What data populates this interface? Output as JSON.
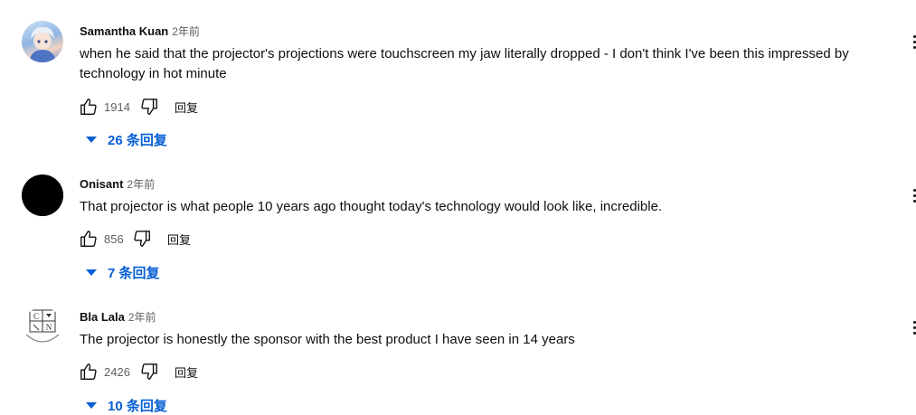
{
  "comments": [
    {
      "author": "Samantha Kuan",
      "time": "2年前",
      "text": "when he said that the projector's projections were touchscreen my jaw literally dropped - I don't think I've been this impressed by technology in hot minute",
      "likes": "1914",
      "reply_label": "回复",
      "replies_label": "26 条回复",
      "avatar": "anime-avatar"
    },
    {
      "author": "Onisant",
      "time": "2年前",
      "text": "That projector is what people 10 years ago thought today's technology would look like, incredible.",
      "likes": "856",
      "reply_label": "回复",
      "replies_label": "7 条回复",
      "avatar": "black-circle-avatar"
    },
    {
      "author": "Bla Lala",
      "time": "2年前",
      "text": "The projector is honestly the sponsor with the best product I have seen in 14 years",
      "likes": "2426",
      "reply_label": "回复",
      "replies_label": "10 条回复",
      "avatar": "logo-avatar",
      "avatar_letters": [
        "C",
        "N"
      ]
    }
  ],
  "icons": {
    "like": "thumbs-up-icon",
    "dislike": "thumbs-down-icon",
    "expand": "triangle-down-icon",
    "menu": "more-vertical-icon"
  },
  "colors": {
    "link_blue": "#065fd4",
    "secondary_text": "#606060",
    "primary_text": "#0f0f0f"
  }
}
